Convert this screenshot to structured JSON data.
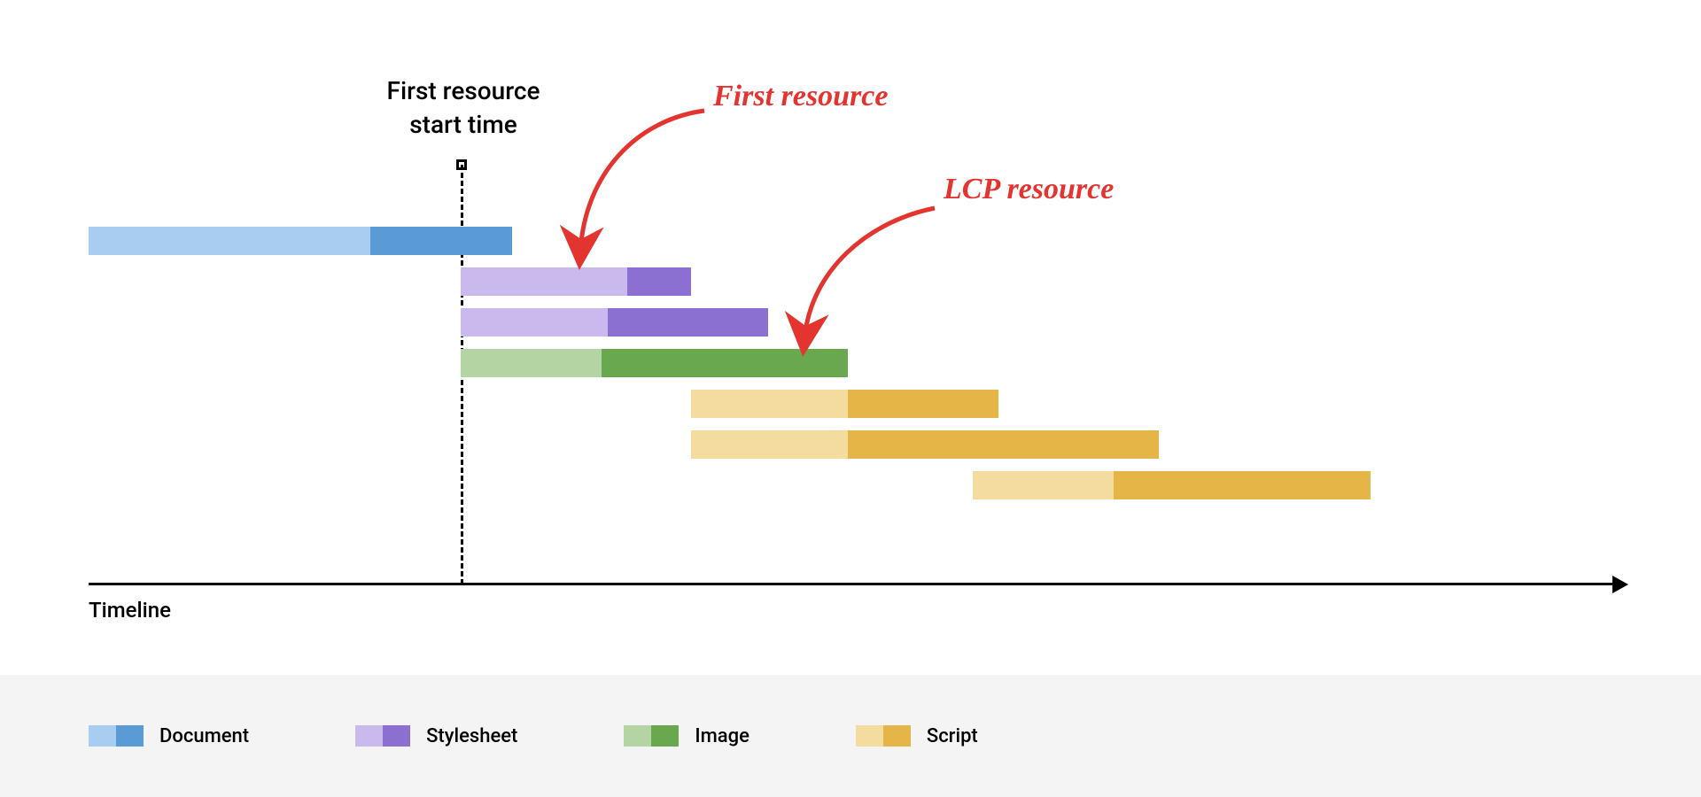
{
  "chart_data": {
    "type": "bar",
    "orientation": "horizontal-gantt",
    "title": "",
    "xlabel": "Timeline",
    "ylabel": "",
    "xlim": [
      0,
      1000
    ],
    "marker": {
      "name": "First resource start time",
      "x": 290
    },
    "annotations": [
      {
        "text": "First resource",
        "target_row": 1
      },
      {
        "text": "LCP resource",
        "target_row": 3
      }
    ],
    "rows": [
      {
        "type": "Document",
        "start": 0,
        "wait_end": 220,
        "end": 330
      },
      {
        "type": "Stylesheet",
        "start": 290,
        "wait_end": 420,
        "end": 470
      },
      {
        "type": "Stylesheet",
        "start": 290,
        "wait_end": 405,
        "end": 530
      },
      {
        "type": "Image",
        "start": 290,
        "wait_end": 400,
        "end": 592
      },
      {
        "type": "Script",
        "start": 470,
        "wait_end": 592,
        "end": 710
      },
      {
        "type": "Script",
        "start": 470,
        "wait_end": 592,
        "end": 835
      },
      {
        "type": "Script",
        "start": 690,
        "wait_end": 800,
        "end": 1000
      }
    ],
    "legend": [
      {
        "type": "Document",
        "light": "#a9cdf0",
        "dark": "#5b9bd5"
      },
      {
        "type": "Stylesheet",
        "light": "#c9b9ec",
        "dark": "#8b6fd1"
      },
      {
        "type": "Image",
        "light": "#b4d4a3",
        "dark": "#6aa84f"
      },
      {
        "type": "Script",
        "light": "#f4dca0",
        "dark": "#e5b548"
      }
    ]
  },
  "labels": {
    "timeline": "Timeline",
    "marker": "First resource\nstart time",
    "first_resource": "First resource",
    "lcp_resource": "LCP resource",
    "legend_document": "Document",
    "legend_stylesheet": "Stylesheet",
    "legend_image": "Image",
    "legend_script": "Script"
  },
  "colors": {
    "doc_light": "#a9cdf0",
    "doc_dark": "#5b9bd5",
    "sty_light": "#c9b9ec",
    "sty_dark": "#8b6fd1",
    "img_light": "#b4d4a3",
    "img_dark": "#6aa84f",
    "scr_light": "#f4dca0",
    "scr_dark": "#e5b548",
    "accent_red": "#e3342f"
  }
}
